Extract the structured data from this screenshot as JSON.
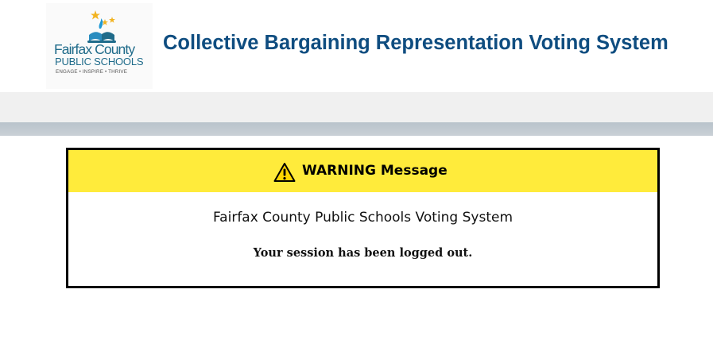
{
  "header": {
    "logo": {
      "name_line1": "Fairfax County",
      "name_line2": "PUBLIC SCHOOLS",
      "tagline": "ENGAGE • INSPIRE • THRIVE"
    },
    "app_title": "Collective Bargaining Representation Voting System"
  },
  "message": {
    "icon": "warning-triangle-icon",
    "title": "WARNING Message",
    "line1": "Fairfax County Public Schools Voting System",
    "line2": "Your session has been logged out."
  },
  "colors": {
    "title_blue": "#0f4d80",
    "logo_teal": "#1f6b8a",
    "warning_yellow": "#ffeb3b",
    "nav_gray": "#f0f0f0",
    "nav_band": "#c2cbd2"
  }
}
